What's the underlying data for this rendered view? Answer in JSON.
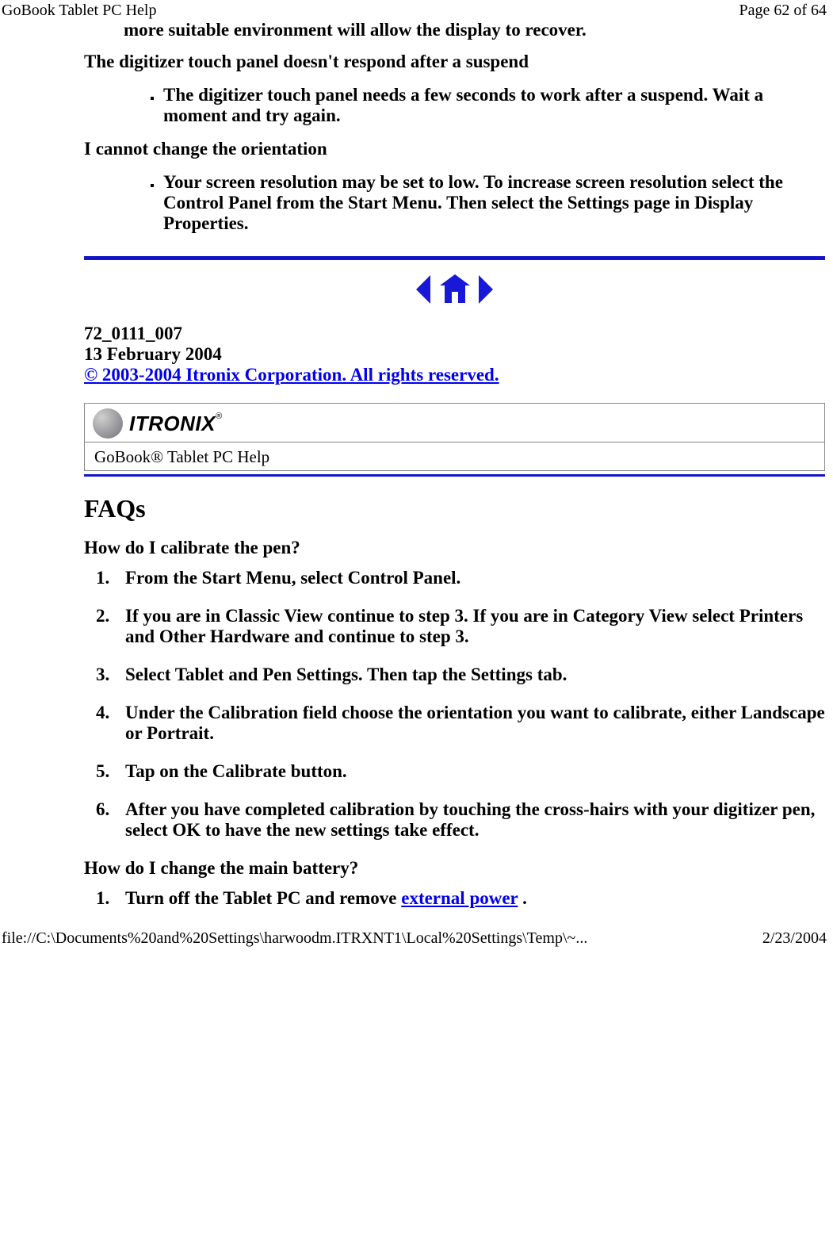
{
  "header": {
    "title": "GoBook Tablet PC Help",
    "page_indicator": "Page 62 of 64"
  },
  "top_fragment": "more suitable environment will allow the display to recover.",
  "section_digitizer": {
    "heading": "The digitizer touch panel doesn't respond after a suspend",
    "bullet": "The digitizer touch panel needs a few seconds to work after a suspend.  Wait a moment and try again."
  },
  "section_orientation": {
    "heading": "I cannot change the orientation",
    "bullet": "Your screen resolution may be set to low.  To increase screen resolution select the Control Panel from the Start Menu.  Then select the Settings page in Display Properties."
  },
  "nav": {
    "prev": "back-icon",
    "home": "home-icon",
    "next": "forward-icon"
  },
  "doc_meta": {
    "id": "72_0111_007",
    "date": "13 February 2004",
    "copyright": "© 2003-2004 Itronix Corporation.  All rights reserved."
  },
  "brand": {
    "logo_text": "ITRONIX",
    "product_line": "GoBook® Tablet PC Help"
  },
  "faq": {
    "title": "FAQs",
    "q1": {
      "question": "How do I calibrate the pen?",
      "steps": [
        "From the Start Menu, select Control Panel.",
        "If you are in Classic View continue to step 3.  If you are in Category View select Printers and Other Hardware and continue to step 3.",
        "Select Tablet and Pen Settings. Then tap the Settings tab.",
        "Under the Calibration field choose the orientation you want to calibrate, either Landscape or Portrait.",
        "Tap on the Calibrate button.",
        "After you have completed calibration by touching the cross-hairs with your digitizer pen, select OK to have the new settings take effect."
      ]
    },
    "q2": {
      "question": "How do I change the main battery?",
      "step1_pre": "Turn off the Tablet PC and remove ",
      "step1_link": "external power",
      "step1_post": " ."
    }
  },
  "footer": {
    "path": "file://C:\\Documents%20and%20Settings\\harwoodm.ITRXNT1\\Local%20Settings\\Temp\\~...",
    "date": "2/23/2004"
  }
}
